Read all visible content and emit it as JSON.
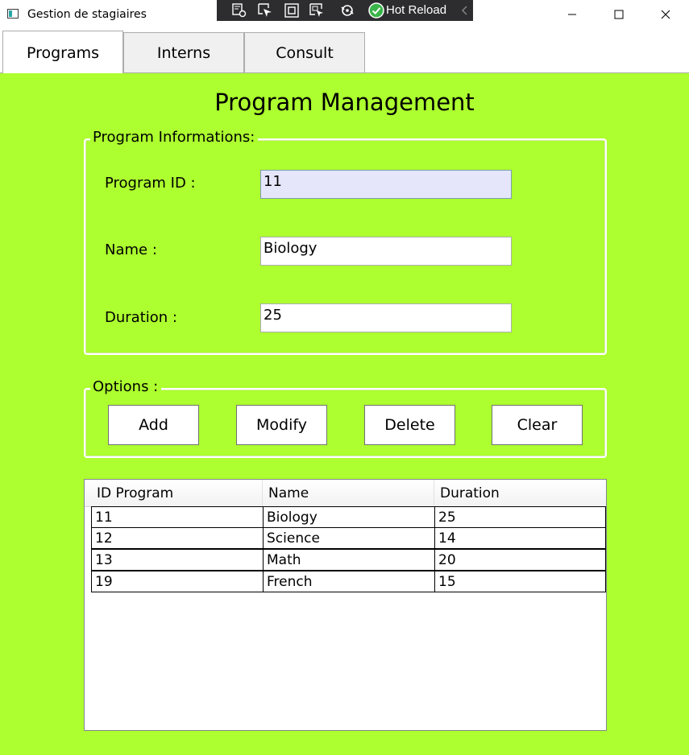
{
  "window": {
    "title": "Gestion de stagiaires"
  },
  "devtoolbar": {
    "hot_reload_label": "Hot Reload"
  },
  "tabs": [
    {
      "label": "Programs",
      "selected": true
    },
    {
      "label": "Interns",
      "selected": false
    },
    {
      "label": "Consult",
      "selected": false
    }
  ],
  "page": {
    "title": "Program Management"
  },
  "program_info": {
    "legend": "Program Informations:",
    "fields": {
      "id": {
        "label": "Program ID :",
        "value": "11"
      },
      "name": {
        "label": "Name :",
        "value": "Biology"
      },
      "duration": {
        "label": "Duration :",
        "value": "25"
      }
    }
  },
  "options": {
    "legend": "Options :",
    "buttons": {
      "add": "Add",
      "modify": "Modify",
      "delete": "Delete",
      "clear": "Clear"
    }
  },
  "grid": {
    "columns": [
      "ID Program",
      "Name",
      "Duration"
    ],
    "rows": [
      [
        "11",
        "Biology",
        "25"
      ],
      [
        "12",
        "Science",
        "14"
      ],
      [
        "13",
        "Math",
        "20"
      ],
      [
        "19",
        "French",
        "15"
      ]
    ]
  },
  "colors": {
    "content_background": "#adff2f",
    "focused_textbox": "#e6e6fa",
    "devbar_background": "#2d2d30",
    "hot_reload_check": "#3bb54a"
  },
  "icons": [
    "app-icon",
    "live-visual-tree-icon",
    "select-element-icon",
    "display-layout-adorners-icon",
    "track-focus-icon",
    "binding-failures-icon",
    "hot-reload-check-icon",
    "collapse-chevron-icon",
    "minimize-icon",
    "maximize-icon",
    "close-icon"
  ]
}
